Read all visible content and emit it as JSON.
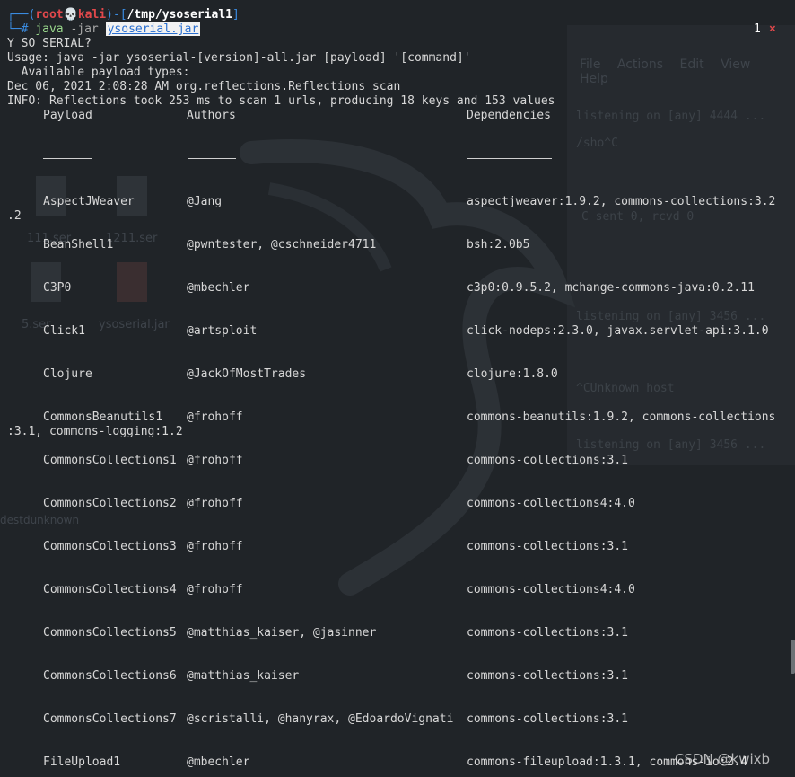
{
  "prompt": {
    "user": "root",
    "skull_glyph": "💀",
    "host": "kali",
    "path": "/tmp/ysoserial1",
    "hash": "#",
    "command_java": "java",
    "command_args": "-jar",
    "command_selected": "ysoserial.jar"
  },
  "tab": {
    "number": "1",
    "close_glyph": "×"
  },
  "output": {
    "line1": "Y SO SERIAL?",
    "line2": "Usage: java -jar ysoserial-[version]-all.jar [payload] '[command]'",
    "line3": "  Available payload types:",
    "line4": "Dec 06, 2021 2:08:28 AM org.reflections.Reflections scan",
    "line5": "INFO: Reflections took 253 ms to scan 1 urls, producing 18 keys and 153 values"
  },
  "table": {
    "headers": {
      "payload": "Payload",
      "authors": "Authors",
      "dependencies": "Dependencies"
    },
    "rows": [
      {
        "payload": "AspectJWeaver",
        "authors": "@Jang",
        "dependencies": "aspectjweaver:1.9.2, commons-collections:3.2",
        "wrap": ".2"
      },
      {
        "payload": "BeanShell1",
        "authors": "@pwntester, @cschneider4711",
        "dependencies": "bsh:2.0b5"
      },
      {
        "payload": "C3P0",
        "authors": "@mbechler",
        "dependencies": "c3p0:0.9.5.2, mchange-commons-java:0.2.11"
      },
      {
        "payload": "Click1",
        "authors": "@artsploit",
        "dependencies": "click-nodeps:2.3.0, javax.servlet-api:3.1.0"
      },
      {
        "payload": "Clojure",
        "authors": "@JackOfMostTrades",
        "dependencies": "clojure:1.8.0"
      },
      {
        "payload": "CommonsBeanutils1",
        "authors": "@frohoff",
        "dependencies": "commons-beanutils:1.9.2, commons-collections",
        "wrap": ":3.1, commons-logging:1.2"
      },
      {
        "payload": "CommonsCollections1",
        "authors": "@frohoff",
        "dependencies": "commons-collections:3.1"
      },
      {
        "payload": "CommonsCollections2",
        "authors": "@frohoff",
        "dependencies": "commons-collections4:4.0"
      },
      {
        "payload": "CommonsCollections3",
        "authors": "@frohoff",
        "dependencies": "commons-collections:3.1"
      },
      {
        "payload": "CommonsCollections4",
        "authors": "@frohoff",
        "dependencies": "commons-collections4:4.0"
      },
      {
        "payload": "CommonsCollections5",
        "authors": "@matthias_kaiser, @jasinner",
        "dependencies": "commons-collections:3.1"
      },
      {
        "payload": "CommonsCollections6",
        "authors": "@matthias_kaiser",
        "dependencies": "commons-collections:3.1"
      },
      {
        "payload": "CommonsCollections7",
        "authors": "@scristalli, @hanyrax, @EdoardoVignati",
        "dependencies": "commons-collections:3.1"
      },
      {
        "payload": "FileUpload1",
        "authors": "@mbechler",
        "dependencies": "commons-fileupload:1.3.1, commons-io:2.4"
      }
    ]
  },
  "background": {
    "menu": [
      "File",
      "Actions",
      "Edit",
      "View",
      "Help"
    ],
    "file_labels": [
      "111.ser",
      "1211.ser",
      "5.ser",
      "ysoserial.jar"
    ],
    "ghost_lines": [
      "listening on [any] 4444 ...",
      "/sho^C",
      "C sent 0, rcvd 0",
      "listening on [any] 3456 ...",
      "^CUnknown host",
      "listening on [any] 3456 ..."
    ],
    "desktop_text": "destdunknown"
  },
  "watermark": "CSDN @kwixb",
  "colors": {
    "background": "#202428",
    "prompt_blue": "#3a8be0",
    "root_red": "#e0484b",
    "java_green": "#9ad98c"
  }
}
